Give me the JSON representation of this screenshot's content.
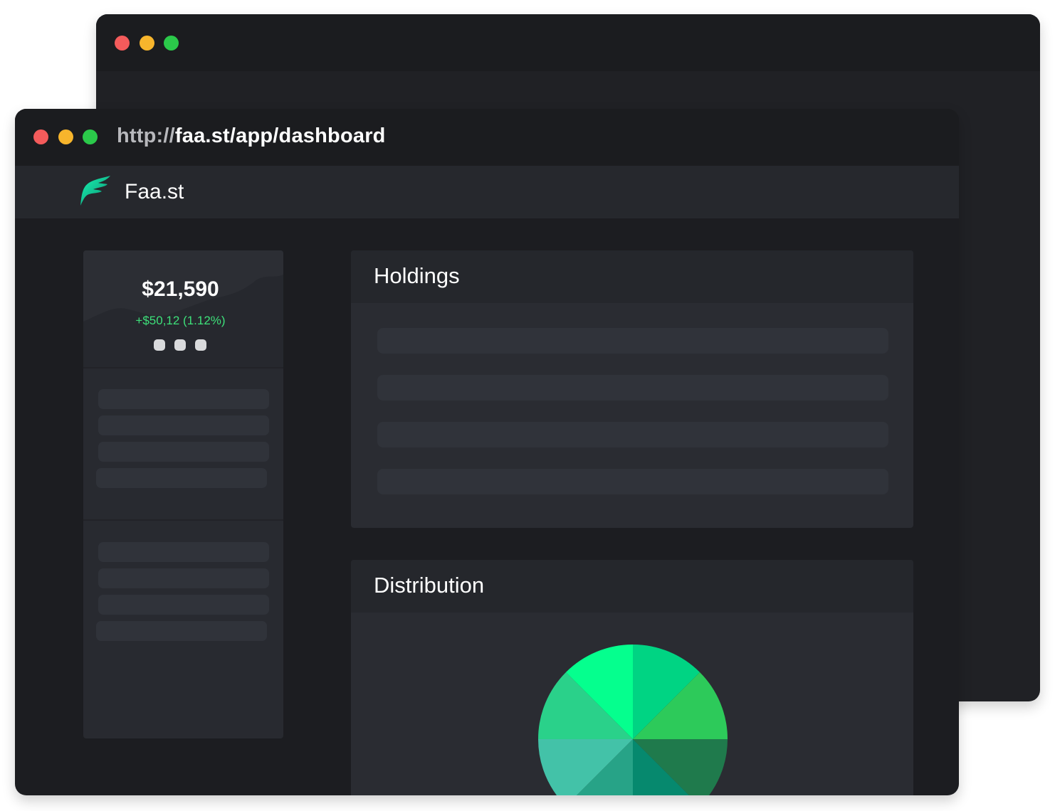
{
  "browser": {
    "url_protocol": "http://",
    "url_path": "faa.st/app/dashboard"
  },
  "app": {
    "brand": "Faa.st",
    "logo_icon": "feather-leaf-icon",
    "accent_color": "#00e28a"
  },
  "balance": {
    "value": "$21,590",
    "change": "+$50,12 (1.12%)",
    "change_color": "#3ee07a",
    "pager_pages": 3
  },
  "holdings": {
    "title": "Holdings",
    "placeholder_rows": 4
  },
  "distribution": {
    "title": "Distribution",
    "slice_colors": [
      "#00d483",
      "#2dca5a",
      "#1f7a4c",
      "#06896e",
      "#27a387",
      "#43c2a8",
      "#2ad18a",
      "#05ff8e"
    ]
  }
}
